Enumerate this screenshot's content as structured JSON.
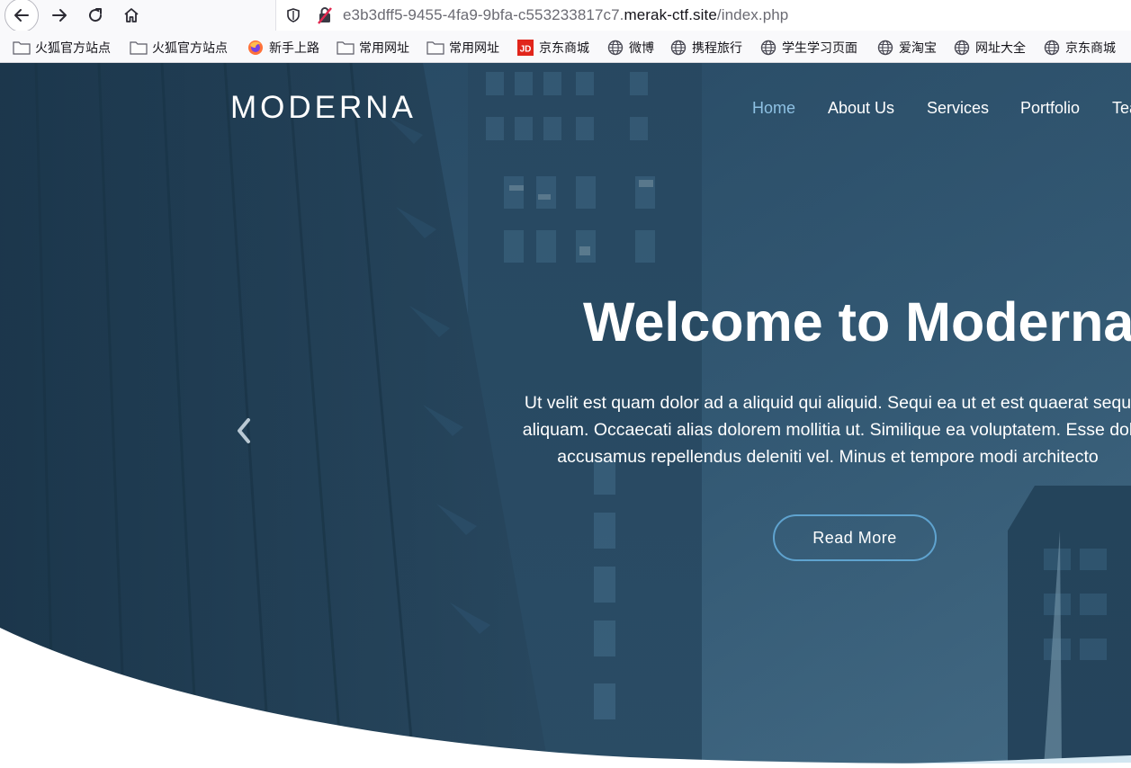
{
  "browser": {
    "url_prefix": "e3b3dff5-9455-4fa9-9bfa-c553233817c7.",
    "url_domain": "merak-ctf.site",
    "url_path": "/index.php"
  },
  "bookmarks": [
    {
      "label": "火狐官方站点",
      "icon": "folder-icon"
    },
    {
      "label": "火狐官方站点",
      "icon": "folder-icon"
    },
    {
      "label": "新手上路",
      "icon": "firefox-icon"
    },
    {
      "label": "常用网址",
      "icon": "folder-icon"
    },
    {
      "label": "常用网址",
      "icon": "folder-icon"
    },
    {
      "label": "京东商城",
      "icon": "jd-icon"
    },
    {
      "label": "微博",
      "icon": "globe-icon"
    },
    {
      "label": "携程旅行",
      "icon": "globe-icon"
    },
    {
      "label": "学生学习页面",
      "icon": "globe-icon"
    },
    {
      "label": "爱淘宝",
      "icon": "globe-icon"
    },
    {
      "label": "网址大全",
      "icon": "globe-icon"
    },
    {
      "label": "京东商城",
      "icon": "globe-icon"
    }
  ],
  "site": {
    "logo": "MODERNA",
    "nav": [
      {
        "label": "Home",
        "active": true
      },
      {
        "label": "About Us",
        "active": false
      },
      {
        "label": "Services",
        "active": false
      },
      {
        "label": "Portfolio",
        "active": false
      },
      {
        "label": "Tea",
        "active": false
      }
    ]
  },
  "hero": {
    "title": "Welcome to Moderna",
    "text_lines": [
      "Ut velit est quam dolor ad a aliquid qui aliquid. Sequi ea ut et est quaerat sequ",
      "aliquam. Occaecati alias dolorem mollitia ut. Similique ea voluptatem. Esse dol",
      "accusamus repellendus deleniti vel. Minus et tempore modi architecto"
    ],
    "button": "Read More"
  },
  "colors": {
    "hero_overlay": "#1f3f58",
    "nav_active": "#8ec1e3",
    "button_border": "#5fa3cf",
    "wave_light": "#d2e6f1"
  }
}
